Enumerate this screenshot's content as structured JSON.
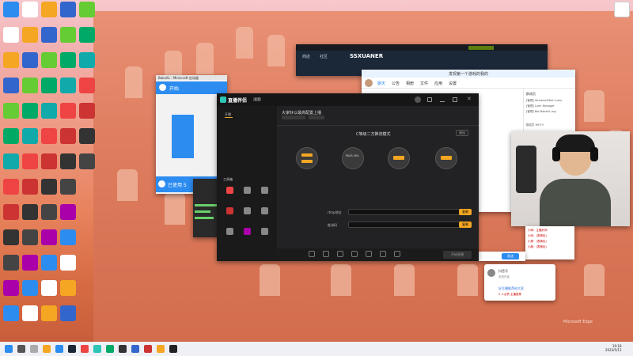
{
  "accent": "#f5a623",
  "desktop": {
    "icons_left": [
      "",
      "",
      "",
      "",
      "",
      "",
      "",
      "",
      "",
      "",
      "",
      "",
      "",
      "",
      "",
      "",
      "",
      "",
      "",
      "",
      "",
      "",
      "",
      "",
      "",
      "",
      "",
      "",
      "",
      "",
      "",
      "",
      "",
      "",
      "",
      "",
      "",
      "",
      "",
      "",
      "",
      "",
      "",
      "",
      "",
      "",
      "",
      "",
      "",
      "",
      "",
      "",
      "",
      "",
      ""
    ]
  },
  "steam": {
    "menu_store": "商店",
    "menu_community": "社区",
    "username": "SSXUANER"
  },
  "minecraft": {
    "title": "BakaXL - Minecraft 启动器",
    "start_label": "开始",
    "used_label": "已使用 S"
  },
  "obs": {
    "logo": "直播伴侣",
    "version": "4.0",
    "room_title": "大家好以最高配置上播",
    "tab1": "开播",
    "mode_text": "C等级二方推流模式",
    "close": "退出",
    "step_labels": [
      "PASS",
      "PASS URL",
      "",
      ""
    ],
    "field1_label": "rtmp地址",
    "field2_label": "推流码",
    "copy_label": "复制",
    "start_button": "开始直播",
    "left_section": "工具箱"
  },
  "qq": {
    "title": "发现第一个游戏的我的",
    "nav": [
      "聊天",
      "公告",
      "相册",
      "文件",
      "应用",
      "设置"
    ],
    "list_header": "群成员",
    "members": [
      "[管理] StreamerMod Lumo",
      "[管理] Lumi Manager",
      "[管理] Bot BakaXL.org"
    ],
    "count": "群成员 69/79"
  },
  "chat": {
    "send_label": "发送",
    "lines": [
      "小明：主播好帅",
      "小帅：(表情包)",
      "小美：(表情包)",
      "小超：(表情包)"
    ],
    "popup_name": "抖音号",
    "popup_tag": "未知作者",
    "popup_msg": "好主播推荐给大家",
    "popup_meta": "2 人点赞 主播推荐"
  },
  "systray": {
    "time": "19:18",
    "date": "2023/5/11"
  },
  "watermark": "Microsoft Edge"
}
